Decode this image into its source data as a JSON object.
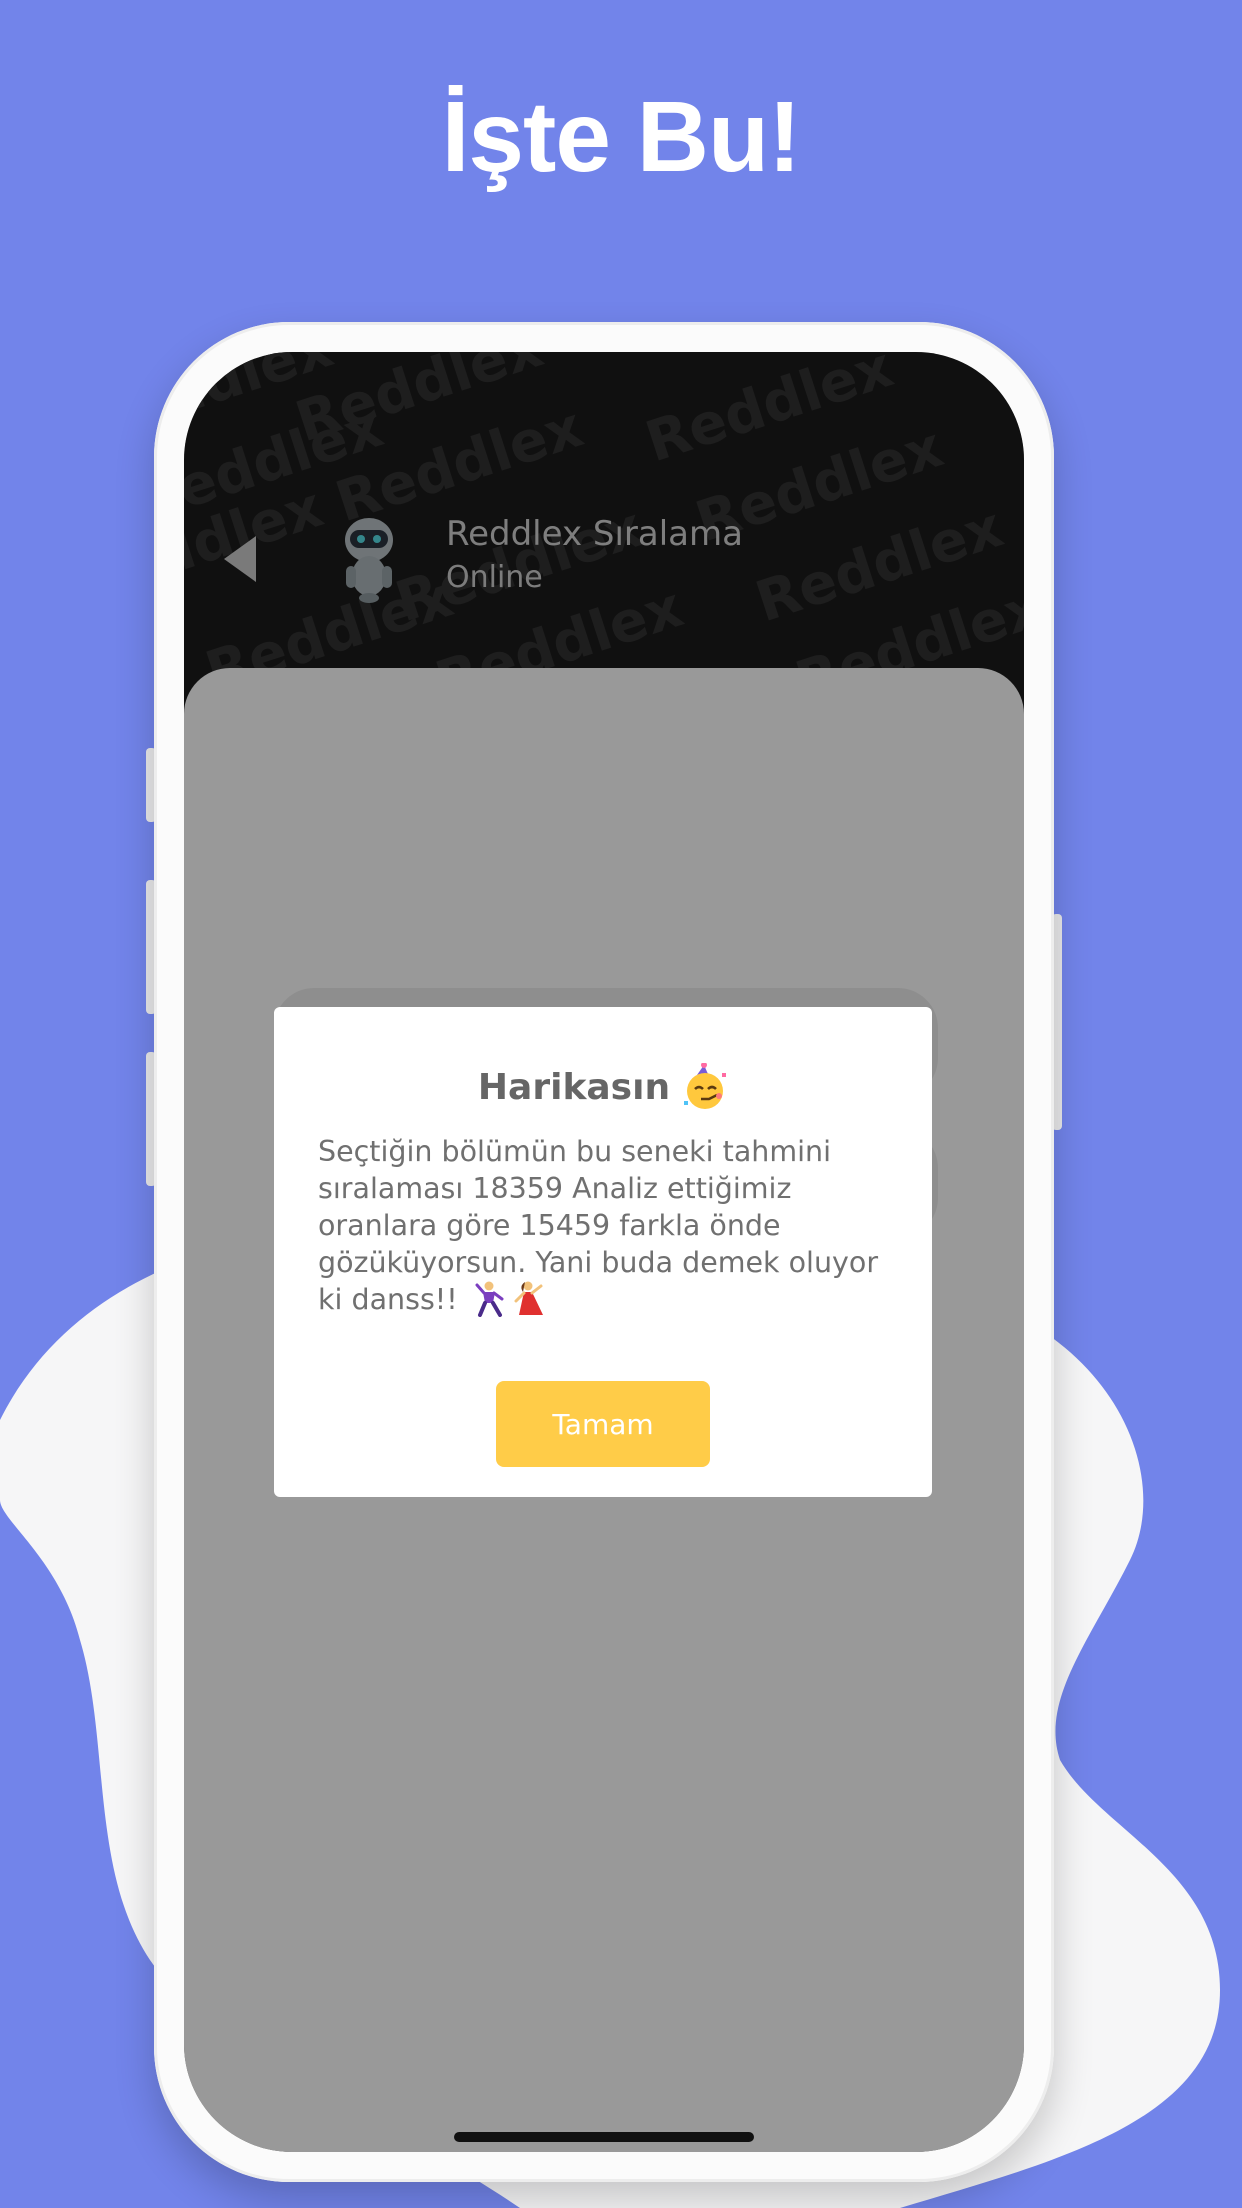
{
  "headline": "İşte Bu!",
  "colors": {
    "background": "#7284EA",
    "accent_button": "#FFCC48",
    "header_bg": "#1C1C1C",
    "dialog_bg": "#FFFFFF"
  },
  "chat_header": {
    "title": "Reddlex Sıralama",
    "status": "Online",
    "back_icon": "back-arrow-icon",
    "avatar_icon": "robot-icon",
    "watermark_text": "Reddlex"
  },
  "dialog": {
    "title": "Harikasın",
    "title_emoji": "partying-face-icon",
    "body": "Seçtiğin bölümün bu seneki tahmini sıralaması 18359 Analiz ettiğimiz oranlara göre 15459 farkla önde gözüküyorsun. Yani buda demek oluyor ki danss!!",
    "body_emoji": [
      "man-dancing-icon",
      "woman-dancing-icon"
    ],
    "button_label": "Tamam"
  }
}
